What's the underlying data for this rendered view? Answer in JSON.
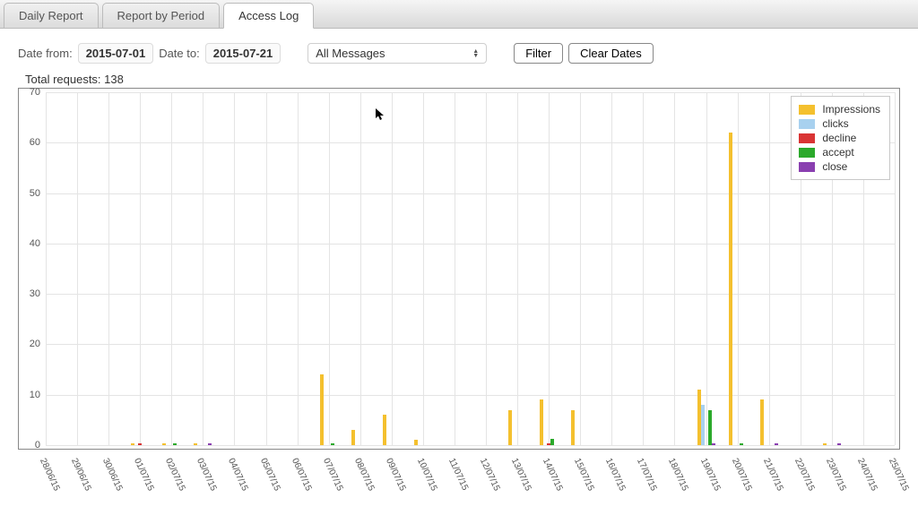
{
  "tabs": [
    {
      "label": "Daily Report",
      "active": false
    },
    {
      "label": "Report by Period",
      "active": false
    },
    {
      "label": "Access Log",
      "active": true
    }
  ],
  "controls": {
    "date_from_label": "Date from:",
    "date_from": "2015-07-01",
    "date_to_label": "Date to:",
    "date_to": "2015-07-21",
    "message_filter": "All Messages",
    "filter_btn": "Filter",
    "clear_btn": "Clear Dates"
  },
  "total_label": "Total requests: 138",
  "legend": [
    {
      "name": "Impressions",
      "color": "#f4c02e"
    },
    {
      "name": "clicks",
      "color": "#a8d1ef"
    },
    {
      "name": "decline",
      "color": "#d93434"
    },
    {
      "name": "accept",
      "color": "#2ba92b"
    },
    {
      "name": "close",
      "color": "#8a3fb0"
    }
  ],
  "chart_data": {
    "type": "bar",
    "xlabel": "",
    "ylabel": "",
    "ylim": [
      0,
      70
    ],
    "yticks": [
      0,
      10,
      20,
      30,
      40,
      50,
      60,
      70
    ],
    "categories": [
      "28/06/15",
      "29/06/15",
      "30/06/15",
      "01/07/15",
      "02/07/15",
      "03/07/15",
      "04/07/15",
      "05/07/15",
      "06/07/15",
      "07/07/15",
      "08/07/15",
      "09/07/15",
      "10/07/15",
      "11/07/15",
      "12/07/15",
      "13/07/15",
      "14/07/15",
      "15/07/15",
      "16/07/15",
      "17/07/15",
      "18/07/15",
      "19/07/15",
      "20/07/15",
      "21/07/15",
      "22/07/15",
      "23/07/15",
      "24/07/15",
      "25/07/15"
    ],
    "series": [
      {
        "name": "Impressions",
        "color": "#f4c02e",
        "values": [
          0,
          0,
          0,
          0.3,
          0.3,
          0.3,
          0,
          0,
          0,
          14,
          3,
          6,
          1,
          0,
          0,
          7,
          9,
          7,
          0,
          0,
          0,
          11,
          62,
          9,
          0,
          0.3,
          0,
          0
        ]
      },
      {
        "name": "clicks",
        "color": "#a8d1ef",
        "values": [
          0,
          0,
          0,
          0,
          0,
          0,
          0,
          0,
          0,
          0,
          0,
          0,
          0,
          0,
          0,
          0,
          0,
          0,
          0,
          0,
          0,
          8,
          0,
          0,
          0,
          0,
          0,
          0
        ]
      },
      {
        "name": "decline",
        "color": "#d93434",
        "values": [
          0,
          0,
          0,
          0.3,
          0,
          0,
          0,
          0,
          0,
          0,
          0,
          0,
          0,
          0,
          0,
          0,
          0.3,
          0,
          0,
          0,
          0,
          0,
          0,
          0,
          0,
          0,
          0,
          0
        ]
      },
      {
        "name": "accept",
        "color": "#2ba92b",
        "values": [
          0,
          0,
          0,
          0,
          0.3,
          0,
          0,
          0,
          0,
          0.3,
          0,
          0,
          0,
          0,
          0,
          0,
          1.2,
          0,
          0,
          0,
          0,
          7,
          0.3,
          0,
          0,
          0,
          0,
          0
        ]
      },
      {
        "name": "close",
        "color": "#8a3fb0",
        "values": [
          0,
          0,
          0,
          0,
          0,
          0.3,
          0,
          0,
          0,
          0,
          0,
          0,
          0,
          0,
          0,
          0,
          0,
          0,
          0,
          0,
          0,
          0.3,
          0,
          0.3,
          0,
          0.3,
          0,
          0
        ]
      }
    ]
  }
}
